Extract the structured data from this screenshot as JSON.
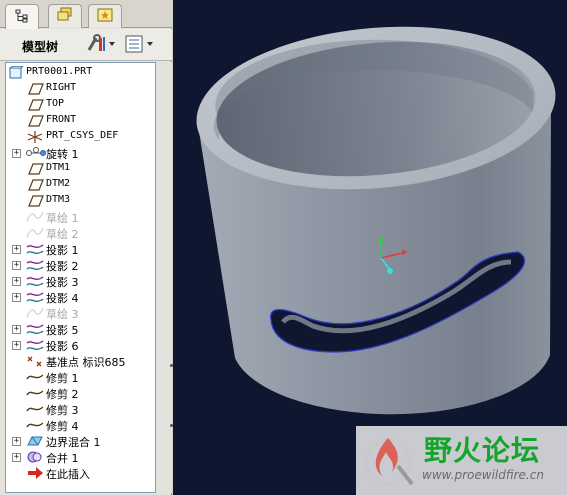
{
  "tabs": [
    {
      "icon": "model-tree-icon",
      "active": true
    },
    {
      "icon": "folder-browser-icon",
      "active": false
    },
    {
      "icon": "favorites-icon",
      "active": false
    }
  ],
  "toolbar": {
    "title": "模型树",
    "settings_icon": "tree-settings-icon",
    "show_icon": "tree-show-icon"
  },
  "tree": {
    "root": "PRT0001.PRT",
    "items": [
      {
        "label": "RIGHT",
        "icon": "datum-plane-icon",
        "expandable": false,
        "suppressed": false,
        "mono": true
      },
      {
        "label": "TOP",
        "icon": "datum-plane-icon",
        "expandable": false,
        "suppressed": false,
        "mono": true
      },
      {
        "label": "FRONT",
        "icon": "datum-plane-icon",
        "expandable": false,
        "suppressed": false,
        "mono": true
      },
      {
        "label": "PRT_CSYS_DEF",
        "icon": "coordinate-system-icon",
        "expandable": false,
        "suppressed": false,
        "mono": true
      },
      {
        "label": "旋转 1",
        "icon": "revolve-icon",
        "expandable": true,
        "suppressed": false,
        "mono": false
      },
      {
        "label": "DTM1",
        "icon": "datum-plane-icon",
        "expandable": false,
        "suppressed": false,
        "mono": true
      },
      {
        "label": "DTM2",
        "icon": "datum-plane-icon",
        "expandable": false,
        "suppressed": false,
        "mono": true
      },
      {
        "label": "DTM3",
        "icon": "datum-plane-icon",
        "expandable": false,
        "suppressed": false,
        "mono": true
      },
      {
        "label": "草绘 1",
        "icon": "sketch-icon",
        "expandable": false,
        "suppressed": true,
        "mono": false
      },
      {
        "label": "草绘 2",
        "icon": "sketch-icon",
        "expandable": false,
        "suppressed": true,
        "mono": false
      },
      {
        "label": "投影 1",
        "icon": "projection-icon",
        "expandable": true,
        "suppressed": false,
        "mono": false
      },
      {
        "label": "投影 2",
        "icon": "projection-icon",
        "expandable": true,
        "suppressed": false,
        "mono": false
      },
      {
        "label": "投影 3",
        "icon": "projection-icon",
        "expandable": true,
        "suppressed": false,
        "mono": false
      },
      {
        "label": "投影 4",
        "icon": "projection-icon",
        "expandable": true,
        "suppressed": false,
        "mono": false
      },
      {
        "label": "草绘 3",
        "icon": "sketch-icon",
        "expandable": false,
        "suppressed": true,
        "mono": false
      },
      {
        "label": "投影 5",
        "icon": "projection-icon",
        "expandable": true,
        "suppressed": false,
        "mono": false
      },
      {
        "label": "投影 6",
        "icon": "projection-icon",
        "expandable": true,
        "suppressed": false,
        "mono": false
      },
      {
        "label": "基准点 标识685",
        "icon": "datum-point-icon",
        "expandable": false,
        "suppressed": false,
        "mono": false
      },
      {
        "label": "修剪 1",
        "icon": "trim-icon",
        "expandable": false,
        "suppressed": false,
        "mono": false
      },
      {
        "label": "修剪 2",
        "icon": "trim-icon",
        "expandable": false,
        "suppressed": false,
        "mono": false
      },
      {
        "label": "修剪 3",
        "icon": "trim-icon",
        "expandable": false,
        "suppressed": false,
        "mono": false
      },
      {
        "label": "修剪 4",
        "icon": "trim-icon",
        "expandable": false,
        "suppressed": false,
        "mono": false
      },
      {
        "label": "边界混合 1",
        "icon": "boundary-blend-icon",
        "expandable": true,
        "suppressed": false,
        "mono": false
      },
      {
        "label": "合并 1",
        "icon": "merge-icon",
        "expandable": true,
        "suppressed": false,
        "mono": false
      },
      {
        "label": "在此插入",
        "icon": "insert-here-icon",
        "expandable": false,
        "suppressed": false,
        "mono": false
      }
    ]
  },
  "viewport": {
    "background": "#0e1630",
    "model_color": "#8c95a3",
    "edge_color": "#2a3cc8"
  },
  "watermark": {
    "title": "野火论坛",
    "url": "www.proewildfire.cn"
  }
}
